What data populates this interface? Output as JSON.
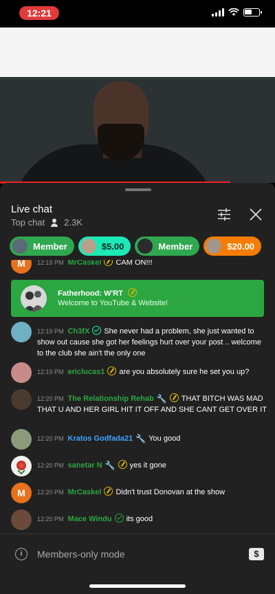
{
  "status_bar": {
    "time": "12:21",
    "battery_level": 0.55
  },
  "chat": {
    "title": "Live chat",
    "mode": "Top chat",
    "viewers": "2.3K"
  },
  "pills": [
    {
      "label": "Member",
      "style": "green",
      "avatar_color": "#5b6a77"
    },
    {
      "label": "$5.00",
      "style": "teal",
      "avatar_color": "#b9a08a"
    },
    {
      "label": "Member",
      "style": "green",
      "avatar_color": "#2b2b2b"
    },
    {
      "label": "$20.00",
      "style": "orange",
      "avatar_color": "#a4968b"
    }
  ],
  "messages": [
    {
      "time": "12:19 PM",
      "author": "MrCaskel",
      "badge": "gold",
      "text": "CAM ON!!!",
      "avatar_letter": "M",
      "avatar_color": "#e8711a"
    },
    {
      "time": "12:19 PM",
      "author": "Ch3fX",
      "badge": "teal",
      "text": "She never had a problem, she just wanted to show out cause she got her feelings hurt over your post .. welcome to the club she ain't the only one",
      "avatar_letter": "",
      "avatar_color": "#6fb0c4"
    },
    {
      "time": "12:19 PM",
      "author": "ericlucas1",
      "badge": "gold",
      "text": "are you absolutely sure he set you up?",
      "avatar_letter": "",
      "avatar_color": "#c98a8a"
    },
    {
      "time": "12:20 PM",
      "author": "The Relationship Rehab",
      "badge": "gold",
      "wrench": true,
      "text": "THAT BITCH WAS MAD THAT U AND HER GIRL HIT IT OFF AND SHE CANT GET OVER IT",
      "avatar_letter": "",
      "avatar_color": "#4a3b2e"
    },
    {
      "time": "12:20 PM",
      "author": "Kratos Godfada21",
      "badge": "",
      "wrench": true,
      "author_style": "blue",
      "text": "You good",
      "avatar_letter": "",
      "avatar_color": "#8a9a7a"
    },
    {
      "time": "12:20 PM",
      "author": "sanetar N",
      "badge": "gold",
      "wrench": true,
      "text": "yes it gone",
      "avatar_letter": "",
      "avatar_color": "#f2f2f2"
    },
    {
      "time": "12:20 PM",
      "author": "MrCaskel",
      "badge": "gold",
      "text": "Didn't trust Donovan at the show",
      "avatar_letter": "M",
      "avatar_color": "#e8711a"
    },
    {
      "time": "12:20 PM",
      "author": "Mace Windu",
      "badge": "green",
      "text": "its good",
      "avatar_letter": "",
      "avatar_color": "#6a4a3a"
    }
  ],
  "membership": {
    "name": "Fatherhood: W'RT",
    "text": "Welcome to YouTube & Website!"
  },
  "footer": {
    "info_glyph": "i",
    "mode_text": "Members-only mode",
    "dollar_glyph": "$"
  },
  "colors": {
    "accent_red": "#e22222",
    "member_green": "#2ba640",
    "super_teal": "#1de9b6",
    "super_orange": "#f57c00"
  }
}
